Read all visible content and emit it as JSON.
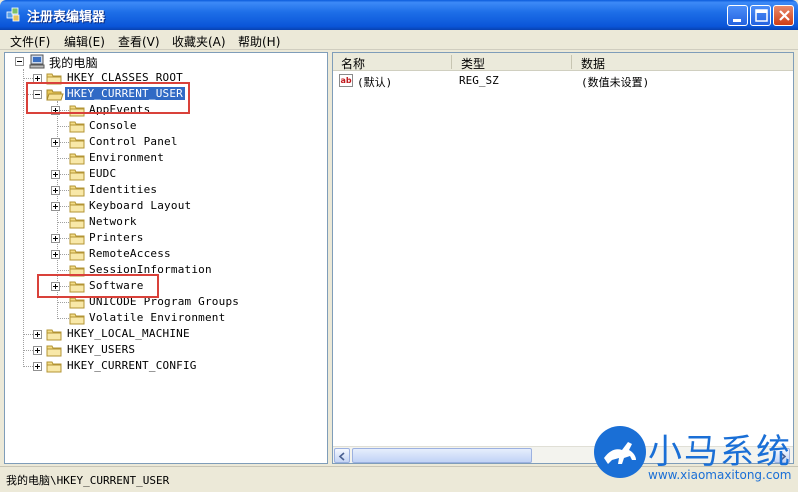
{
  "window": {
    "title": "注册表编辑器"
  },
  "menu": [
    "文件(F)",
    "编辑(E)",
    "查看(V)",
    "收藏夹(A)",
    "帮助(H)"
  ],
  "tree": {
    "root": "我的电脑",
    "nodes": [
      {
        "label": "HKEY_CLASSES_ROOT"
      },
      {
        "label": "HKEY_CURRENT_USER"
      },
      {
        "label": "AppEvents"
      },
      {
        "label": "Console"
      },
      {
        "label": "Control Panel"
      },
      {
        "label": "Environment"
      },
      {
        "label": "EUDC"
      },
      {
        "label": "Identities"
      },
      {
        "label": "Keyboard Layout"
      },
      {
        "label": "Network"
      },
      {
        "label": "Printers"
      },
      {
        "label": "RemoteAccess"
      },
      {
        "label": "SessionInformation"
      },
      {
        "label": "Software"
      },
      {
        "label": "UNICODE Program Groups"
      },
      {
        "label": "Volatile Environment"
      },
      {
        "label": "HKEY_LOCAL_MACHINE"
      },
      {
        "label": "HKEY_USERS"
      },
      {
        "label": "HKEY_CURRENT_CONFIG"
      }
    ],
    "selected": "HKEY_CURRENT_USER"
  },
  "list": {
    "columns": [
      "名称",
      "类型",
      "数据"
    ],
    "rows": [
      {
        "icon": "string-value-icon",
        "icon_text": "ab",
        "name": "(默认)",
        "type": "REG_SZ",
        "data": "(数值未设置)"
      }
    ]
  },
  "status": {
    "path": "我的电脑\\HKEY_CURRENT_USER"
  },
  "watermark": {
    "title": "小马系统",
    "url": "www.xiaomaxitong.com"
  },
  "colors": {
    "titlebar": "#0a55d8",
    "selection": "#316ac5",
    "highlight_box": "#d9413a",
    "watermark": "#1a6fd6"
  }
}
